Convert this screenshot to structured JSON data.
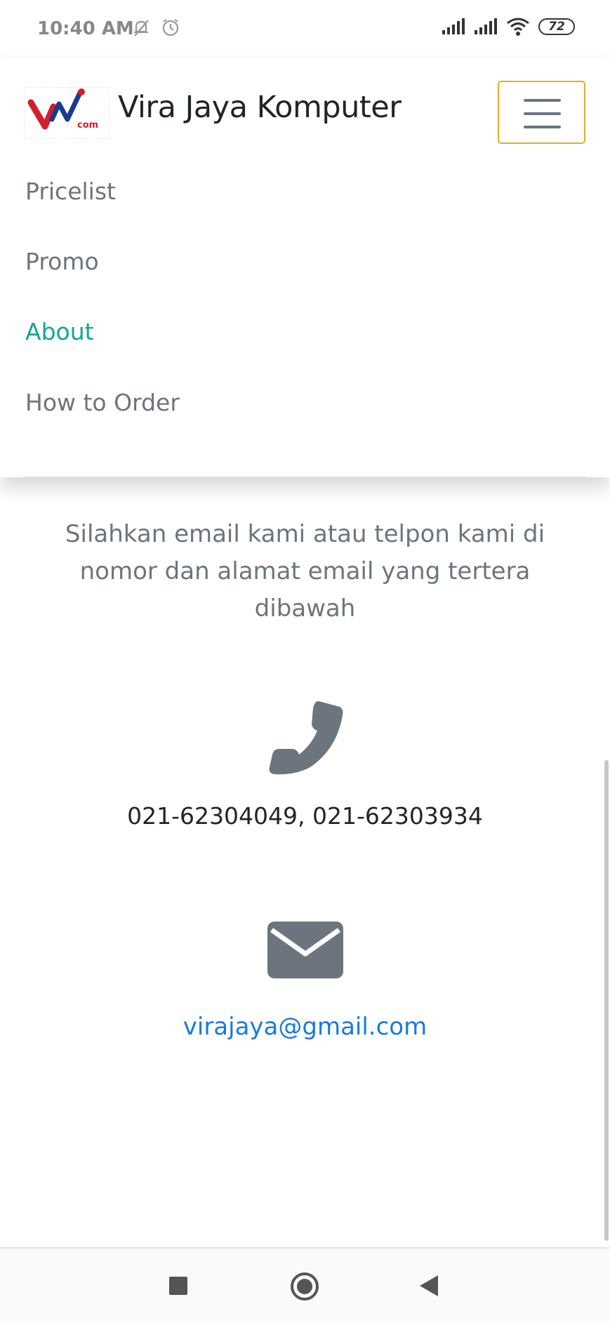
{
  "status": {
    "time": "10:40 AM",
    "battery": "72"
  },
  "navbar": {
    "brand": "Vira Jaya Komputer",
    "logo_text": "com",
    "links": [
      {
        "label": "Pricelist",
        "active": false
      },
      {
        "label": "Promo",
        "active": false
      },
      {
        "label": "About",
        "active": true
      },
      {
        "label": "How to Order",
        "active": false
      }
    ]
  },
  "content": {
    "intro": "Silahkan email kami atau telpon kami di nomor dan alamat email yang tertera dibawah",
    "phone": "021-62304049, 021-62303934",
    "email": "virajaya@gmail.com"
  },
  "colors": {
    "accent": "#18a397",
    "link": "#1a7bd6",
    "toggler_border": "#e3ac2f",
    "muted": "#6c757d"
  },
  "icons": {
    "phone": "phone-icon",
    "mail": "envelope-icon",
    "menu": "hamburger-icon"
  }
}
